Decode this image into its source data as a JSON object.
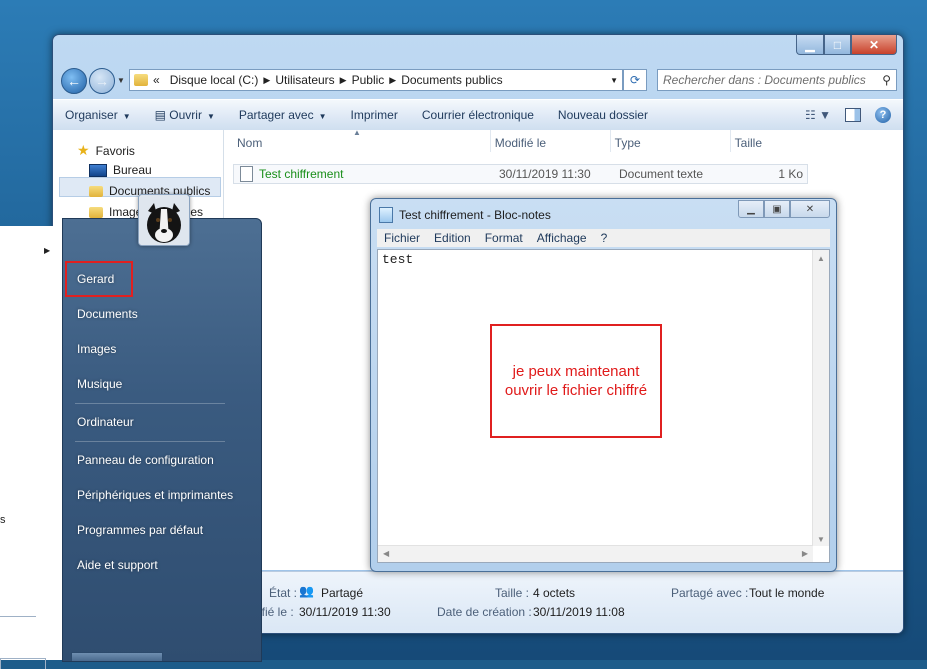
{
  "explorer": {
    "address": {
      "chevron": "«",
      "crumbs": [
        "Disque local (C:)",
        "Utilisateurs",
        "Public",
        "Documents publics"
      ]
    },
    "search_placeholder": "Rechercher dans : Documents publics",
    "toolbar": {
      "organiser": "Organiser",
      "ouvrir": "Ouvrir",
      "partager": "Partager avec",
      "imprimer": "Imprimer",
      "courrier": "Courrier électronique",
      "nouveau_dossier": "Nouveau dossier"
    },
    "nav": {
      "favoris": "Favoris",
      "bureau": "Bureau",
      "documents_publics": "Documents publics",
      "images": "Images publiques"
    },
    "columns": {
      "nom": "Nom",
      "modifie": "Modifié le",
      "type": "Type",
      "taille": "Taille"
    },
    "file": {
      "name": "Test chiffrement",
      "modified": "30/11/2019 11:30",
      "type": "Document texte",
      "size": "1 Ko"
    },
    "details": {
      "etat_label": "État :",
      "etat_value": "Partagé",
      "modifie_label": "ifié le :",
      "modifie_value": "30/11/2019 11:30",
      "taille_label": "Taille :",
      "taille_value": "4 octets",
      "creation_label": "Date de création :",
      "creation_value": "30/11/2019 11:08",
      "partage_label": "Partagé avec :",
      "partage_value": "Tout le monde"
    }
  },
  "notepad": {
    "title": "Test chiffrement - Bloc-notes",
    "menu": [
      "Fichier",
      "Edition",
      "Format",
      "Affichage",
      "?"
    ],
    "text": "test",
    "annotation": "je peux maintenant ouvrir le fichier chiffré"
  },
  "startmenu": {
    "items": {
      "gerard": "Gerard",
      "documents": "Documents",
      "images": "Images",
      "musique": "Musique",
      "ordinateur": "Ordinateur",
      "panneau": "Panneau de configuration",
      "peripheriques": "Périphériques et imprimantes",
      "programmes": "Programmes par défaut",
      "aide": "Aide et support"
    },
    "left_fragment": "s"
  }
}
